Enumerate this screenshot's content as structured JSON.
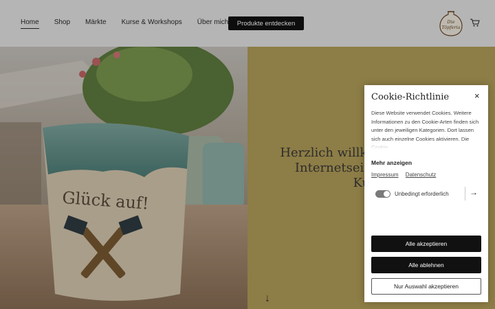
{
  "nav": {
    "items": [
      {
        "label": "Home",
        "active": true
      },
      {
        "label": "Shop"
      },
      {
        "label": "Märkte"
      },
      {
        "label": "Kurse & Workshops"
      },
      {
        "label": "Über mich"
      }
    ],
    "cta_label": "Produkte entdecken",
    "logo_text": "Die Töpferia"
  },
  "hero": {
    "title_lines": [
      "Herzlich willkommen auf der",
      "Internetseite für Töpfer-",
      "Kunst"
    ],
    "mug_text": "Glück auf!"
  },
  "cookie": {
    "title": "Cookie-Richtlinie",
    "close_symbol": "×",
    "body": "Diese Website verwendet Cookies. Weitere Informationen zu den Cookie-Arten finden sich unter den jeweiligen Kategorien. Dort lassen sich auch einzelne Cookies aktivieren. Die Cookie-",
    "more_label": "Mehr anzeigen",
    "links": [
      "Impressum",
      "Datenschutz"
    ],
    "toggle_label": "Unbedingt erforderlich",
    "accept_all": "Alle akzeptieren",
    "reject_all": "Alle ablehnen",
    "accept_selection": "Nur Auswahl akzeptieren"
  },
  "colors": {
    "hero_right": "#b5a05a",
    "button_dark": "#111111"
  }
}
